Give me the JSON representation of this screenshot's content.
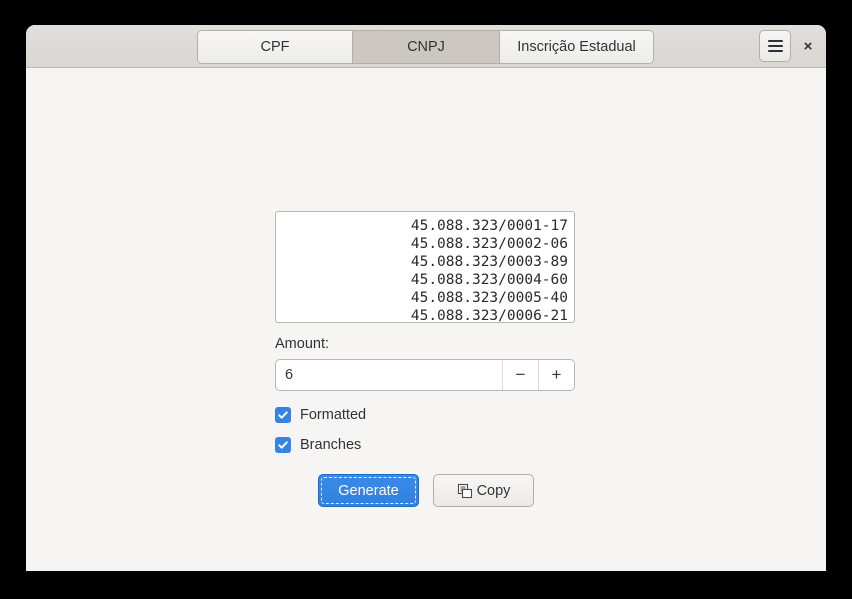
{
  "window": {
    "tabs": [
      {
        "id": "cpf",
        "label": "CPF",
        "active": false
      },
      {
        "id": "cnpj",
        "label": "CNPJ",
        "active": true
      },
      {
        "id": "ie",
        "label": "Inscrição Estadual",
        "active": false
      }
    ],
    "menu_button_icon": "hamburger-icon",
    "close_button_label": "×"
  },
  "main": {
    "results": [
      "45.088.323/0001-17",
      "45.088.323/0002-06",
      "45.088.323/0003-89",
      "45.088.323/0004-60",
      "45.088.323/0005-40",
      "45.088.323/0006-21"
    ],
    "amount_label": "Amount:",
    "amount_value": "6",
    "amount_placeholder": "",
    "stepper": {
      "decrement_label": "−",
      "increment_label": "+"
    },
    "options": [
      {
        "id": "formatted",
        "label": "Formatted",
        "checked": true
      },
      {
        "id": "branches",
        "label": "Branches",
        "checked": true
      }
    ],
    "generate_label": "Generate",
    "copy_label": "Copy",
    "copy_icon": "copy-icon"
  },
  "colors": {
    "accent": "#3584e4",
    "generate_button": "#3081e0",
    "headerbar": "#dad6d2",
    "active_tab": "#cdc7c2",
    "content_bg": "#f6f5f4"
  }
}
